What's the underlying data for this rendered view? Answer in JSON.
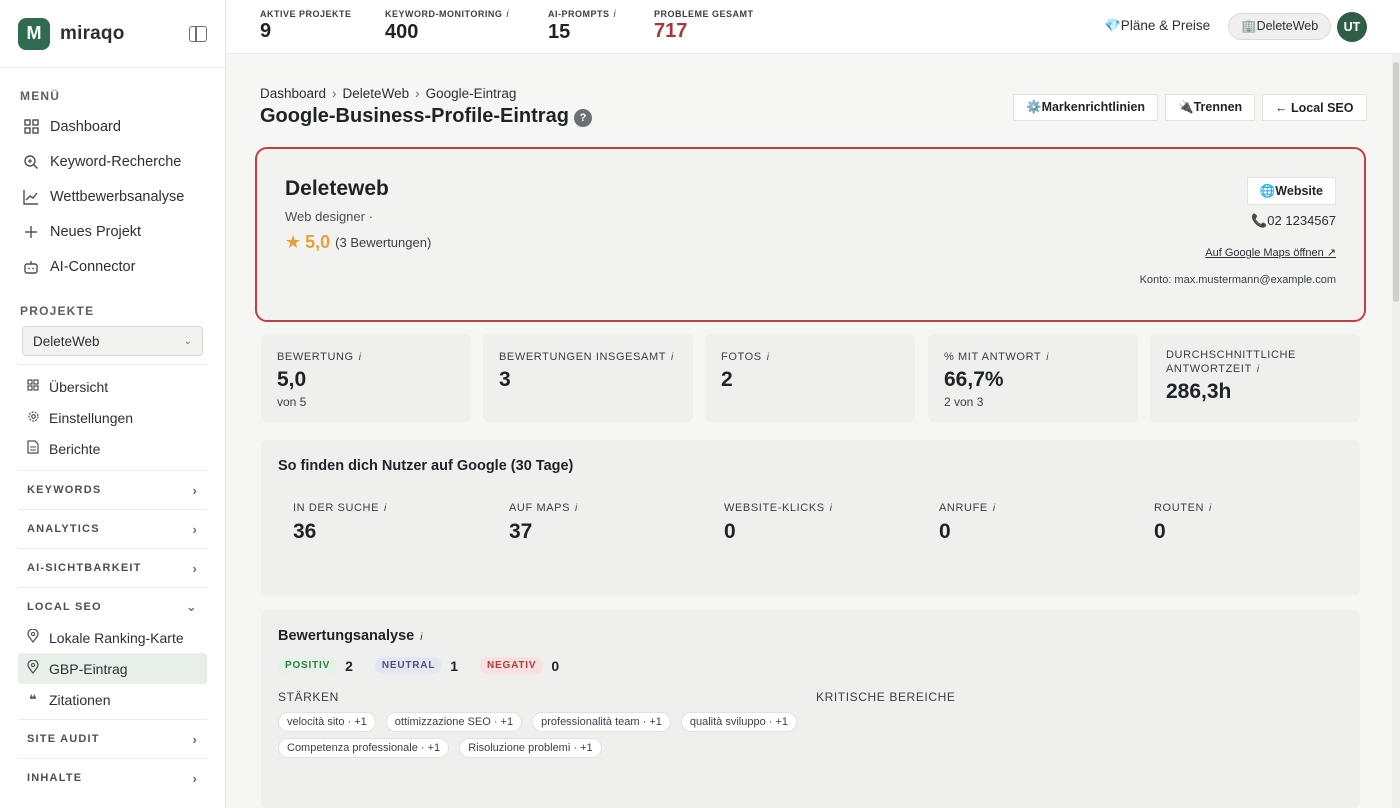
{
  "sidebar": {
    "logo_letter": "M",
    "logo_text": "miraqo",
    "menu_label": "MENÜ",
    "menu": [
      {
        "label": "Dashboard",
        "icon": "grid-icon"
      },
      {
        "label": "Keyword-Recherche",
        "icon": "search-icon"
      },
      {
        "label": "Wettbewerbsanalyse",
        "icon": "chart-line-icon"
      },
      {
        "label": "Neues Projekt",
        "icon": "plus-icon"
      },
      {
        "label": "AI-Connector",
        "icon": "robot-icon"
      }
    ],
    "projects_label": "PROJEKTE",
    "project_select": "DeleteWeb",
    "project_nav": [
      {
        "label": "Übersicht",
        "icon": "grid-icon"
      },
      {
        "label": "Einstellungen",
        "icon": "gear-icon"
      },
      {
        "label": "Berichte",
        "icon": "document-icon"
      }
    ],
    "groups": {
      "keywords": "KEYWORDS",
      "analytics": "ANALYTICS",
      "ai": "AI-SICHTBARKEIT",
      "local_seo": "LOCAL SEO",
      "site_audit": "SITE AUDIT",
      "inhalte": "INHALTE"
    },
    "local_seo_items": [
      {
        "label": "Lokale Ranking-Karte",
        "icon": "pin-icon"
      },
      {
        "label": "GBP-Eintrag",
        "icon": "pin-icon",
        "active": true
      },
      {
        "label": "Zitationen",
        "icon": "quote-icon"
      }
    ]
  },
  "topbar": {
    "stats": [
      {
        "label": "AKTIVE PROJEKTE",
        "value": "9"
      },
      {
        "label": "KEYWORD-MONITORING",
        "value": "400"
      },
      {
        "label": "AI-PROMPTS",
        "value": "15"
      },
      {
        "label": "PROBLEME GESAMT",
        "value": "717"
      }
    ],
    "info_mark": "i",
    "plans": "💎Pläne & Preise",
    "account": "🏢DeleteWeb",
    "avatar": "UT"
  },
  "page": {
    "breadcrumb": [
      "Dashboard",
      "DeleteWeb",
      "Google-Eintrag"
    ],
    "breadcrumb_sep": "›",
    "title": "Google-Business-Profile-Eintrag",
    "help": "?",
    "actions": {
      "brand": "⚙️Markenrichtlinien",
      "disconnect": "🔌Trennen",
      "local_seo": "← Local SEO"
    }
  },
  "profile": {
    "name": "Deleteweb",
    "category": "Web designer ·",
    "rating": "5,0",
    "rating_count": "(3 Bewertungen)",
    "website": "🌐Website",
    "phone": "📞02 1234567",
    "maps": "Auf Google Maps öffnen ↗",
    "konto": "Konto: max.mustermann@example.com"
  },
  "kpis": [
    {
      "label": "BEWERTUNG",
      "value": "5,0",
      "sub": "von 5"
    },
    {
      "label": "BEWERTUNGEN INSGESAMT",
      "value": "3",
      "sub": ""
    },
    {
      "label": "FOTOS",
      "value": "2",
      "sub": ""
    },
    {
      "label": "% MIT ANTWORT",
      "value": "66,7%",
      "sub": "2 von 3"
    },
    {
      "label": "DURCHSCHNITTLICHE ANTWORTZEIT",
      "value": "286,3h",
      "sub": ""
    }
  ],
  "visibility": {
    "title": "So finden dich Nutzer auf Google (30 Tage)",
    "metrics": [
      {
        "label": "IN DER SUCHE",
        "value": "36"
      },
      {
        "label": "AUF MAPS",
        "value": "37"
      },
      {
        "label": "WEBSITE-KLICKS",
        "value": "0"
      },
      {
        "label": "ANRUFE",
        "value": "0"
      },
      {
        "label": "ROUTEN",
        "value": "0"
      }
    ]
  },
  "reviews": {
    "title": "Bewertungsanalyse",
    "positive": {
      "label": "POSITIV",
      "count": "2"
    },
    "neutral": {
      "label": "NEUTRAL",
      "count": "1"
    },
    "negative": {
      "label": "NEGATIV",
      "count": "0"
    },
    "strengths_label": "STÄRKEN",
    "critical_label": "KRITISCHE BEREICHE",
    "chips": [
      "velocità sito · +1",
      "ottimizzazione SEO · +1",
      "professionalità team · +1",
      "qualità sviluppo · +1",
      "Competenza professionale · +1",
      "Risoluzione problemi · +1"
    ]
  }
}
